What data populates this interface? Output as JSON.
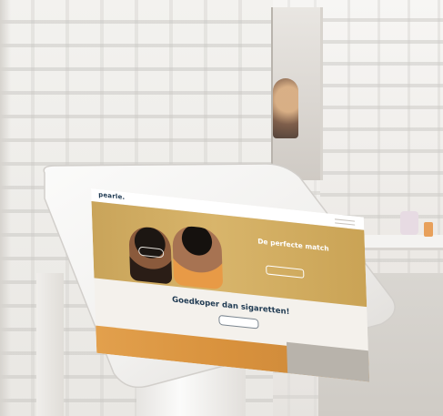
{
  "screen": {
    "brand": "pearle.",
    "hero_title": "De perfecte match",
    "headline": "Goedkoper dan sigaretten!"
  },
  "colors": {
    "hero_bg": "#d2ae63",
    "brand_text": "#1f3a52",
    "accent_orange": "#e2a04d",
    "kiosk_shell": "#f3f2f0"
  }
}
